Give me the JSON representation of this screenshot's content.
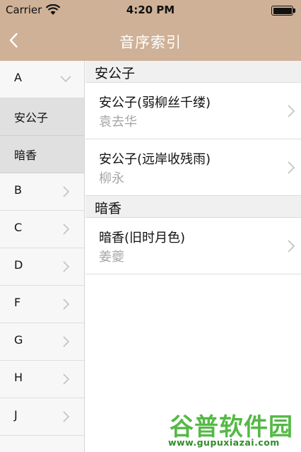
{
  "status_bar": {
    "carrier": "Carrier",
    "time": "4:20 PM",
    "wifi_icon": "wifi-icon",
    "battery_icon": "battery-full-icon"
  },
  "nav": {
    "title": "音序索引",
    "back_icon": "chevron-left-icon"
  },
  "colors": {
    "bar": "#cfb197",
    "sidebar_bg": "#f7f7f7",
    "selected_bg": "#e0e0e0",
    "section_bg": "#f0f0f0",
    "author_text": "#a6a6a6",
    "watermark_green": "#54b946"
  },
  "sidebar": {
    "items": [
      {
        "label": "A",
        "expanded": true
      },
      {
        "label": "安公子",
        "child": true
      },
      {
        "label": "暗香",
        "child": true
      },
      {
        "label": "B"
      },
      {
        "label": "C"
      },
      {
        "label": "D"
      },
      {
        "label": "F"
      },
      {
        "label": "G"
      },
      {
        "label": "H"
      },
      {
        "label": "J"
      }
    ]
  },
  "sections": [
    {
      "header": "安公子",
      "entries": [
        {
          "title": "安公子(弱柳丝千缕)",
          "author": "袁去华"
        },
        {
          "title": "安公子(远岸收残雨)",
          "author": "柳永"
        }
      ]
    },
    {
      "header": "暗香",
      "entries": [
        {
          "title": "暗香(旧时月色)",
          "author": "姜夔"
        }
      ]
    }
  ],
  "watermark": {
    "logo": "谷普软件园",
    "url": "www.gupuxiazai.com"
  }
}
